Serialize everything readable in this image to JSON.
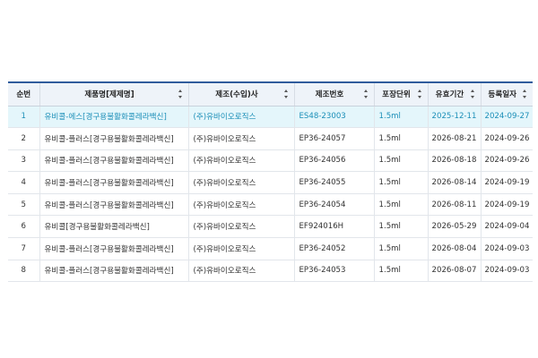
{
  "table": {
    "headers": [
      {
        "label": "순번",
        "sortable": false
      },
      {
        "label": "제품명[제제명]",
        "sortable": true
      },
      {
        "label": "제조(수입)사",
        "sortable": true
      },
      {
        "label": "제조번호",
        "sortable": true
      },
      {
        "label": "포장단위",
        "sortable": true
      },
      {
        "label": "유효기간",
        "sortable": true
      },
      {
        "label": "등록일자",
        "sortable": true
      }
    ],
    "rows": [
      {
        "no": "1",
        "product": "유비콜-에스[경구용불활화콜레라백신]",
        "maker": "(주)유바이오로직스",
        "lot": "ES48-23003",
        "pack": "1.5ml",
        "expiry": "2025-12-11",
        "registered": "2024-09-27",
        "selected": true
      },
      {
        "no": "2",
        "product": "유비콜-플러스[경구용불활화콜레라백신]",
        "maker": "(주)유바이오로직스",
        "lot": "EP36-24057",
        "pack": "1.5ml",
        "expiry": "2026-08-21",
        "registered": "2024-09-26"
      },
      {
        "no": "3",
        "product": "유비콜-플러스[경구용불활화콜레라백신]",
        "maker": "(주)유바이오로직스",
        "lot": "EP36-24056",
        "pack": "1.5ml",
        "expiry": "2026-08-18",
        "registered": "2024-09-26"
      },
      {
        "no": "4",
        "product": "유비콜-플러스[경구용불활화콜레라백신]",
        "maker": "(주)유바이오로직스",
        "lot": "EP36-24055",
        "pack": "1.5ml",
        "expiry": "2026-08-14",
        "registered": "2024-09-19"
      },
      {
        "no": "5",
        "product": "유비콜-플러스[경구용불활화콜레라백신]",
        "maker": "(주)유바이오로직스",
        "lot": "EP36-24054",
        "pack": "1.5ml",
        "expiry": "2026-08-11",
        "registered": "2024-09-19"
      },
      {
        "no": "6",
        "product": "유비콜[경구용불활화콜레라백신]",
        "maker": "(주)유바이오로직스",
        "lot": "EF924016H",
        "pack": "1.5ml",
        "expiry": "2026-05-29",
        "registered": "2024-09-04"
      },
      {
        "no": "7",
        "product": "유비콜-플러스[경구용불활화콜레라백신]",
        "maker": "(주)유바이오로직스",
        "lot": "EP36-24052",
        "pack": "1.5ml",
        "expiry": "2026-08-04",
        "registered": "2024-09-03"
      },
      {
        "no": "8",
        "product": "유비콜-플러스[경구용불활화콜레라백신]",
        "maker": "(주)유바이오로직스",
        "lot": "EP36-24053",
        "pack": "1.5ml",
        "expiry": "2026-08-07",
        "registered": "2024-09-03"
      }
    ]
  },
  "colors": {
    "header_border": "#2f5c9c",
    "header_bg": "#eef3f9",
    "selected_bg": "#e4f6fb",
    "selected_text": "#1c8fb8"
  },
  "icons": {
    "sort": "sort-updown-icon"
  }
}
